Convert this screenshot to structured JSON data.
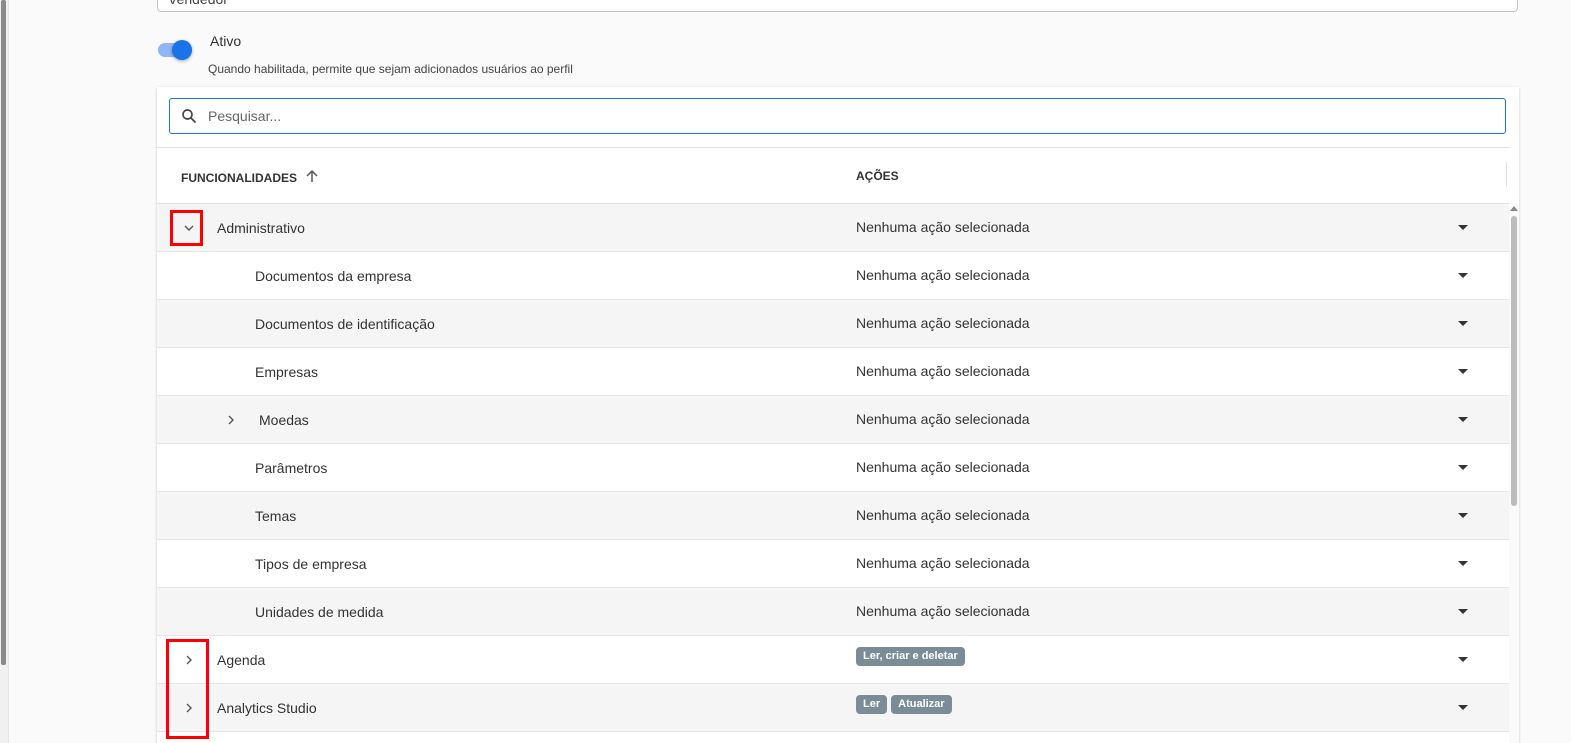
{
  "form": {
    "profile_name_value": "Vendedor",
    "active_toggle": {
      "label": "Ativo",
      "help": "Quando habilitada, permite que sejam adicionados usuários ao perfil",
      "on": true
    }
  },
  "search": {
    "placeholder": "Pesquisar..."
  },
  "table": {
    "col_features": "FUNCIONALIDADES",
    "col_actions": "AÇÕES",
    "rows": [
      {
        "label": "Administrativo",
        "actions": "Nenhuma ação selecionada"
      },
      {
        "label": "Documentos da empresa",
        "actions": "Nenhuma ação selecionada"
      },
      {
        "label": "Documentos de identificação",
        "actions": "Nenhuma ação selecionada"
      },
      {
        "label": "Empresas",
        "actions": "Nenhuma ação selecionada"
      },
      {
        "label": "Moedas",
        "actions": "Nenhuma ação selecionada"
      },
      {
        "label": "Parâmetros",
        "actions": "Nenhuma ação selecionada"
      },
      {
        "label": "Temas",
        "actions": "Nenhuma ação selecionada"
      },
      {
        "label": "Tipos de empresa",
        "actions": "Nenhuma ação selecionada"
      },
      {
        "label": "Unidades de medida",
        "actions": "Nenhuma ação selecionada"
      },
      {
        "label": "Agenda",
        "chips": [
          "Ler, criar e deletar"
        ]
      },
      {
        "label": "Analytics Studio",
        "chips": [
          "Ler",
          "Atualizar"
        ]
      }
    ]
  },
  "colors": {
    "accent": "#1a73e8",
    "highlight": "#ff0000",
    "chip": "#7a8d96"
  }
}
